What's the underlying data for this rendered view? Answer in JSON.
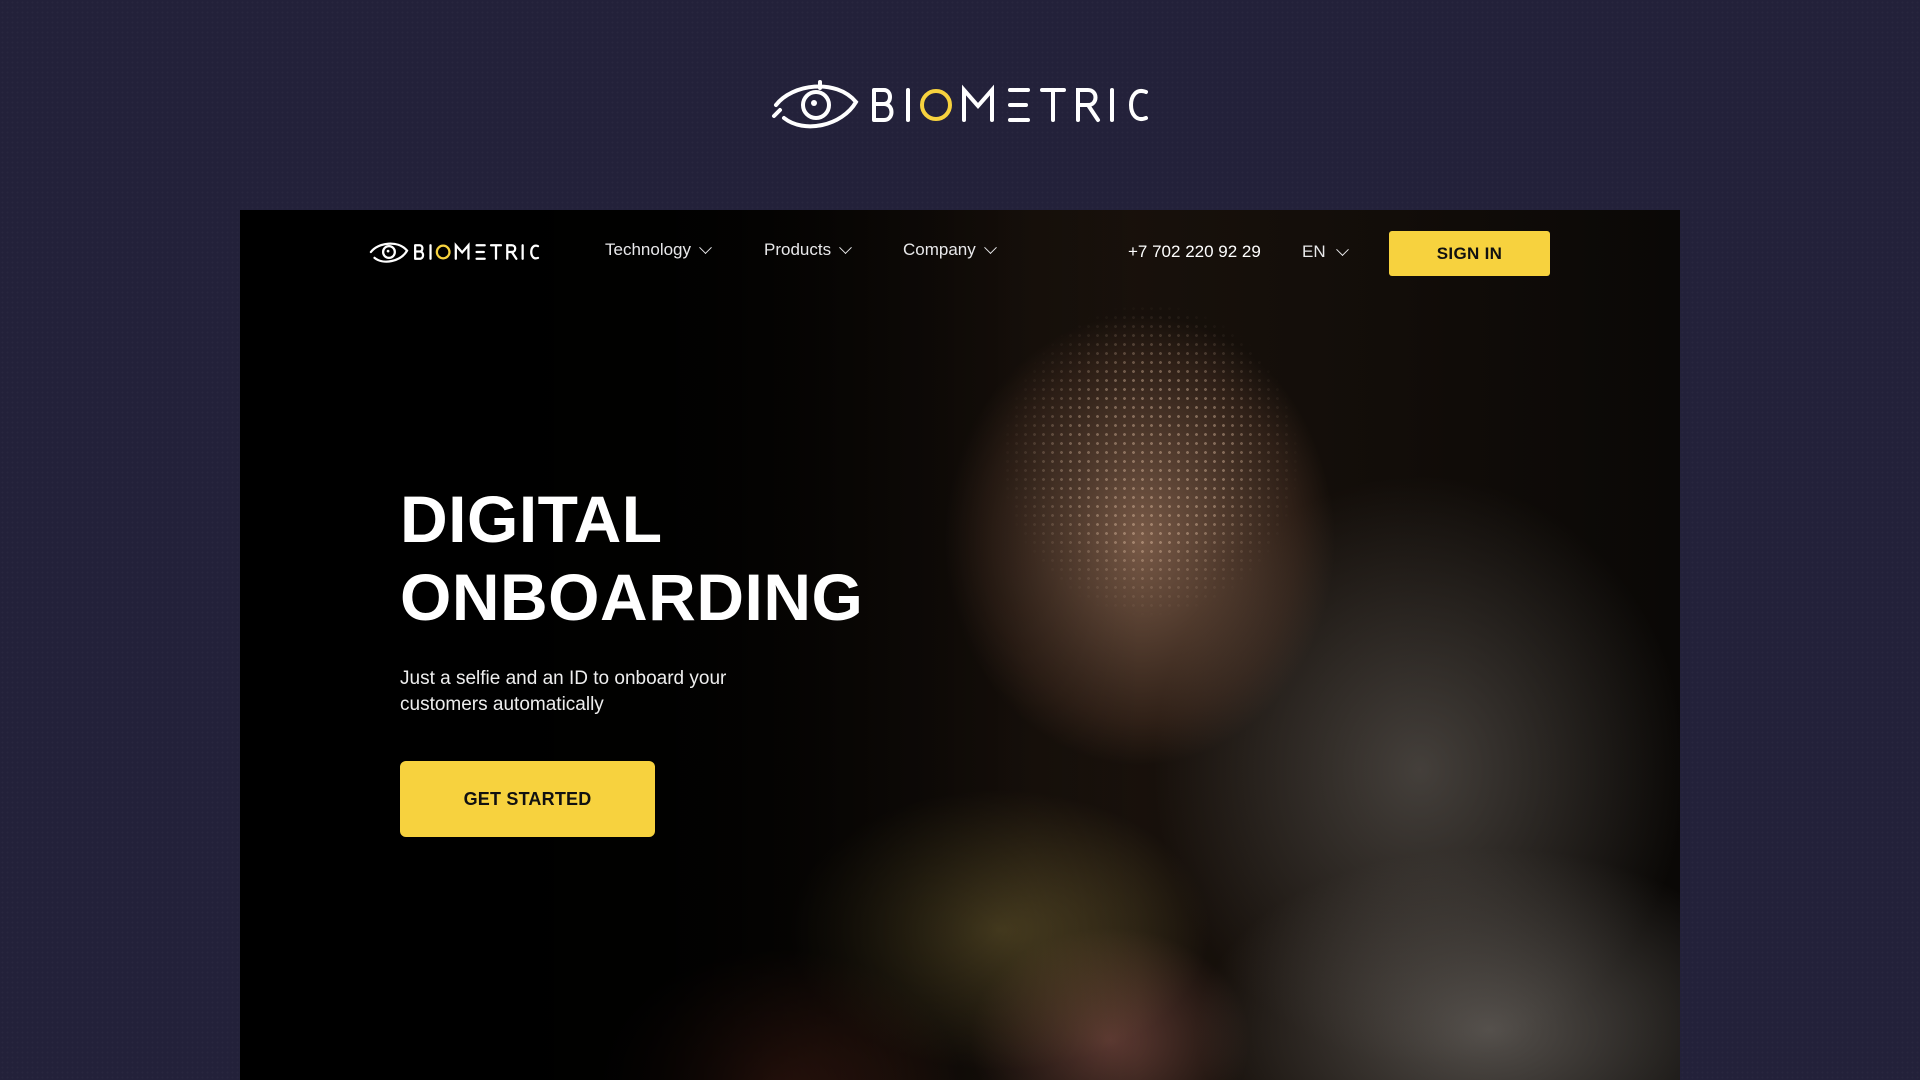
{
  "brand": {
    "name": "BIOMETRIC",
    "accent_color": "#f7d23e",
    "logo_icon": "eye-icon"
  },
  "nav": {
    "items": [
      {
        "label": "Technology",
        "icon": "chevron-down-icon"
      },
      {
        "label": "Products",
        "icon": "chevron-down-icon"
      },
      {
        "label": "Company",
        "icon": "chevron-down-icon"
      }
    ],
    "phone": "+7 702 220 92 29",
    "language": "EN",
    "signin_label": "SIGN IN"
  },
  "hero": {
    "title_line1": "DIGITAL",
    "title_line2": "ONBOARDING",
    "subtitle": "Just a selfie and an ID to onboard your customers automatically",
    "cta_label": "GET STARTED"
  }
}
